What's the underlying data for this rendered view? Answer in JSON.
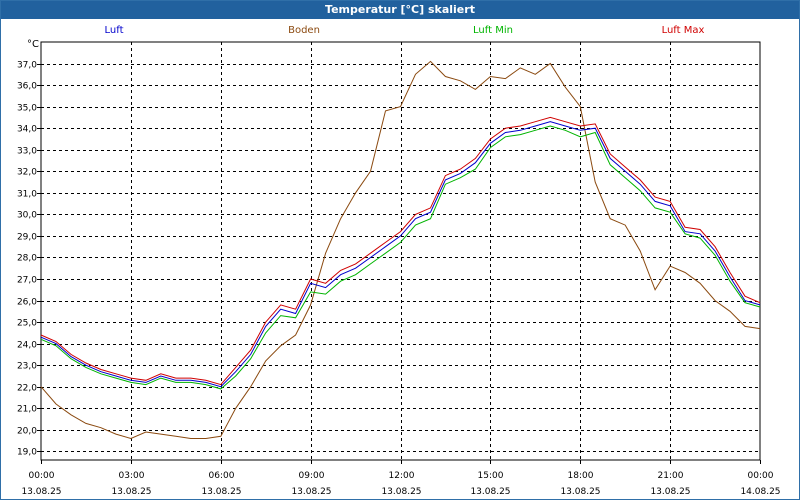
{
  "window": {
    "title": "Temperatur [°C] skaliert"
  },
  "colors": {
    "luft": "#0000cc",
    "boden": "#8b4a10",
    "luft_min": "#00b400",
    "luft_max": "#d00000",
    "title_bar": "#21619e"
  },
  "chart_data": {
    "type": "line",
    "title": "Temperatur [°C] skaliert",
    "ylabel": "°C",
    "ylim": [
      18.6,
      38.0
    ],
    "yticks": [
      "19,0",
      "20,0",
      "21,0",
      "22,0",
      "23,0",
      "24,0",
      "25,0",
      "26,0",
      "27,0",
      "28,0",
      "29,0",
      "30,0",
      "31,0",
      "32,0",
      "33,0",
      "34,0",
      "35,0",
      "36,0",
      "37,0"
    ],
    "xticks": [
      {
        "time": "00:00",
        "date": "13.08.25"
      },
      {
        "time": "03:00",
        "date": "13.08.25"
      },
      {
        "time": "06:00",
        "date": "13.08.25"
      },
      {
        "time": "09:00",
        "date": "13.08.25"
      },
      {
        "time": "12:00",
        "date": "13.08.25"
      },
      {
        "time": "15:00",
        "date": "13.08.25"
      },
      {
        "time": "18:00",
        "date": "13.08.25"
      },
      {
        "time": "21:00",
        "date": "13.08.25"
      },
      {
        "time": "00:00",
        "date": "14.08.25"
      }
    ],
    "x_hours": [
      0,
      0.5,
      1,
      1.5,
      2,
      2.5,
      3,
      3.5,
      4,
      4.5,
      5,
      5.5,
      6,
      6.5,
      7,
      7.5,
      8,
      8.5,
      9,
      9.5,
      10,
      10.5,
      11,
      11.5,
      12,
      12.5,
      13,
      13.5,
      14,
      14.5,
      15,
      15.5,
      16,
      16.5,
      17,
      17.5,
      18,
      18.5,
      19,
      19.5,
      20,
      20.5,
      21,
      21.5,
      22,
      22.5,
      23,
      23.5,
      24
    ],
    "grid": true,
    "legend": "top",
    "series": [
      {
        "name": "Luft",
        "color_key": "luft",
        "values": [
          24.3,
          24.0,
          23.4,
          23.0,
          22.7,
          22.5,
          22.3,
          22.2,
          22.5,
          22.3,
          22.3,
          22.2,
          22.0,
          22.7,
          23.5,
          24.8,
          25.6,
          25.4,
          26.8,
          26.6,
          27.2,
          27.5,
          28.0,
          28.5,
          29.0,
          29.8,
          30.1,
          31.6,
          31.9,
          32.4,
          33.3,
          33.8,
          33.9,
          34.1,
          34.3,
          34.1,
          33.9,
          34.0,
          32.6,
          32.0,
          31.4,
          30.6,
          30.4,
          29.2,
          29.1,
          28.3,
          27.1,
          26.0,
          25.8
        ]
      },
      {
        "name": "Boden",
        "color_key": "boden",
        "values": [
          22.0,
          21.2,
          20.7,
          20.3,
          20.1,
          19.8,
          19.6,
          19.9,
          19.8,
          19.7,
          19.6,
          19.6,
          19.7,
          21.0,
          22.0,
          23.2,
          23.9,
          24.4,
          25.8,
          28.2,
          29.8,
          31.0,
          32.0,
          34.8,
          35.0,
          36.5,
          37.1,
          36.4,
          36.2,
          35.8,
          36.4,
          36.3,
          36.8,
          36.5,
          37.0,
          35.9,
          35.0,
          31.5,
          29.8,
          29.5,
          28.3,
          26.5,
          27.6,
          27.3,
          26.8,
          26.0,
          25.5,
          24.8,
          24.7
        ]
      },
      {
        "name": "Luft Min",
        "color_key": "luft_min",
        "values": [
          24.2,
          23.9,
          23.3,
          22.9,
          22.6,
          22.4,
          22.2,
          22.1,
          22.4,
          22.2,
          22.2,
          22.1,
          21.9,
          22.5,
          23.3,
          24.5,
          25.3,
          25.2,
          26.4,
          26.3,
          26.9,
          27.2,
          27.7,
          28.2,
          28.7,
          29.5,
          29.8,
          31.4,
          31.7,
          32.1,
          33.1,
          33.6,
          33.7,
          33.9,
          34.1,
          33.9,
          33.6,
          33.8,
          32.3,
          31.7,
          31.1,
          30.3,
          30.1,
          29.1,
          28.9,
          28.1,
          26.9,
          25.9,
          25.7
        ]
      },
      {
        "name": "Luft Max",
        "color_key": "luft_max",
        "values": [
          24.4,
          24.1,
          23.5,
          23.1,
          22.8,
          22.6,
          22.4,
          22.3,
          22.6,
          22.4,
          22.4,
          22.3,
          22.1,
          22.9,
          23.7,
          25.0,
          25.8,
          25.6,
          27.0,
          26.8,
          27.4,
          27.7,
          28.2,
          28.7,
          29.2,
          30.0,
          30.3,
          31.8,
          32.1,
          32.6,
          33.5,
          34.0,
          34.1,
          34.3,
          34.5,
          34.3,
          34.1,
          34.2,
          32.8,
          32.2,
          31.6,
          30.8,
          30.6,
          29.4,
          29.3,
          28.5,
          27.3,
          26.2,
          25.9
        ]
      }
    ]
  }
}
